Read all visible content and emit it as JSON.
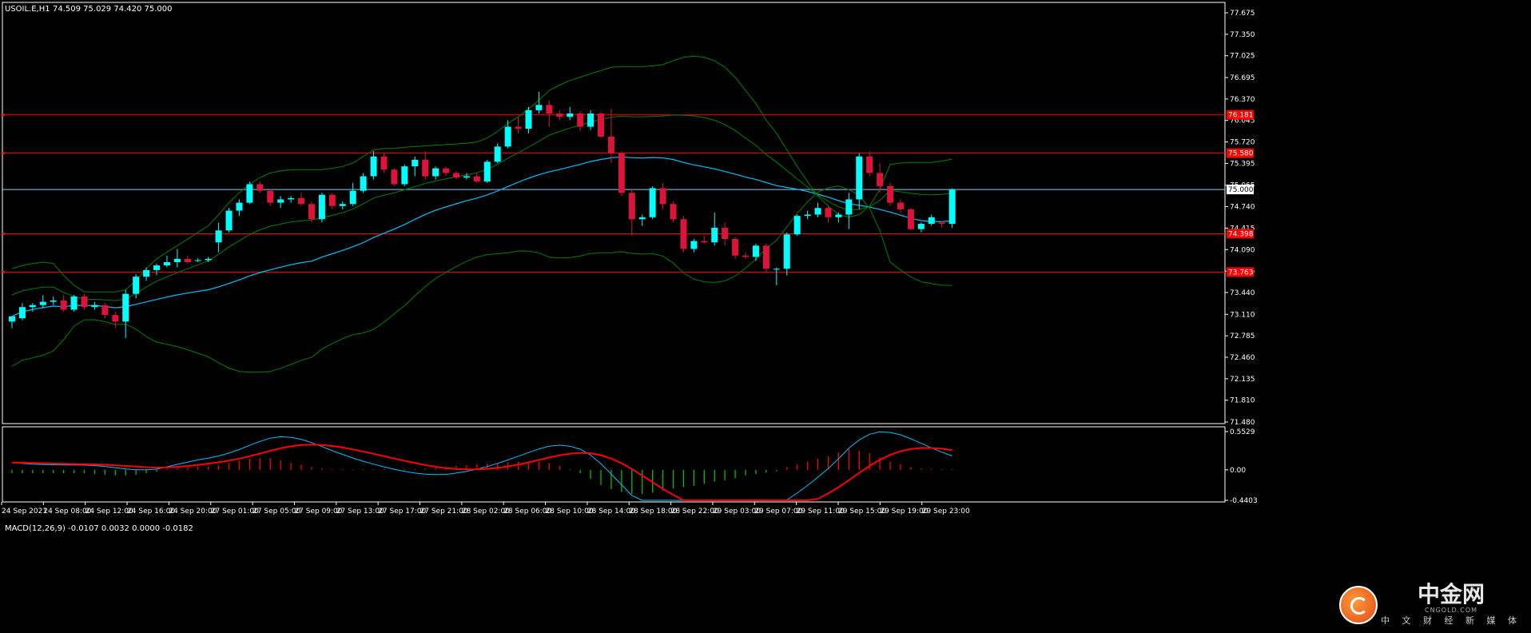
{
  "header": {
    "symbol": "USOIL.E,H1",
    "ohlc": "74.509 75.029 74.420 75.000",
    "macd_title": "MACD(12,26,9) -0.0107 0.0032 0.0000 -0.0182"
  },
  "colors": {
    "background": "#000000",
    "bull": "#00ffff",
    "bear": "#dc143c",
    "band": "#008000",
    "ma": "#00bfff",
    "hline": "#ff0000",
    "macd_signal": "#ff0000",
    "macd_line": "#00bfff",
    "hist_pos": "#ff0000",
    "hist_neg": "#00c000",
    "grid": "#ffffff"
  },
  "chart_data": [
    {
      "type": "candlestick",
      "symbol": "USOIL.E",
      "timeframe": "H1",
      "ylim": [
        71.48,
        77.675
      ],
      "y_ticks": [
        "77.675",
        "77.350",
        "77.025",
        "76.695",
        "76.370",
        "76.045",
        "75.720",
        "75.395",
        "75.065",
        "74.740",
        "74.415",
        "74.090",
        "73.765",
        "73.440",
        "73.110",
        "72.785",
        "72.460",
        "72.135",
        "71.810",
        "71.480"
      ],
      "x_ticks": [
        "24 Sep 2021",
        "24 Sep 08:00",
        "24 Sep 12:00",
        "24 Sep 16:00",
        "24 Sep 20:00",
        "27 Sep 01:00",
        "27 Sep 05:00",
        "27 Sep 09:00",
        "27 Sep 13:00",
        "27 Sep 17:00",
        "27 Sep 21:00",
        "28 Sep 02:00",
        "28 Sep 06:00",
        "28 Sep 10:00",
        "28 Sep 14:00",
        "28 Sep 18:00",
        "28 Sep 22:00",
        "29 Sep 03:00",
        "29 Sep 07:00",
        "29 Sep 11:00",
        "29 Sep 15:00",
        "29 Sep 19:00",
        "29 Sep 23:00"
      ],
      "horizontal_lines": [
        {
          "value": 76.13,
          "label": "76.181"
        },
        {
          "value": 75.55,
          "label": "75.580"
        },
        {
          "value": 74.33,
          "label": "74.398"
        },
        {
          "value": 73.75,
          "label": "73.763"
        }
      ],
      "current_price": {
        "value": 75.0,
        "label": "75.000"
      },
      "candles": [
        [
          73.0,
          73.08,
          72.9,
          73.08
        ],
        [
          73.05,
          73.28,
          73.02,
          73.22
        ],
        [
          73.22,
          73.28,
          73.15,
          73.25
        ],
        [
          73.25,
          73.4,
          73.2,
          73.3
        ],
        [
          73.3,
          73.38,
          73.25,
          73.32
        ],
        [
          73.32,
          73.4,
          73.15,
          73.18
        ],
        [
          73.18,
          73.4,
          73.15,
          73.38
        ],
        [
          73.38,
          73.42,
          73.18,
          73.22
        ],
        [
          73.22,
          73.3,
          73.18,
          73.25
        ],
        [
          73.25,
          73.28,
          73.05,
          73.1
        ],
        [
          73.1,
          73.15,
          72.9,
          73.0
        ],
        [
          73.0,
          73.48,
          72.75,
          73.42
        ],
        [
          73.42,
          73.72,
          73.35,
          73.68
        ],
        [
          73.68,
          73.82,
          73.62,
          73.78
        ],
        [
          73.78,
          73.88,
          73.7,
          73.85
        ],
        [
          73.85,
          74.0,
          73.82,
          73.9
        ],
        [
          73.9,
          74.1,
          73.82,
          73.95
        ],
        [
          73.95,
          74.0,
          73.88,
          73.9
        ],
        [
          73.92,
          73.96,
          73.9,
          73.93
        ],
        [
          73.93,
          73.98,
          73.9,
          73.95
        ],
        [
          74.2,
          74.5,
          74.05,
          74.38
        ],
        [
          74.38,
          74.72,
          74.35,
          74.68
        ],
        [
          74.68,
          74.85,
          74.6,
          74.8
        ],
        [
          74.8,
          75.12,
          74.78,
          75.08
        ],
        [
          75.08,
          75.12,
          74.95,
          74.98
        ],
        [
          74.98,
          75.0,
          74.75,
          74.8
        ],
        [
          74.8,
          74.9,
          74.72,
          74.85
        ],
        [
          74.85,
          74.9,
          74.8,
          74.87
        ],
        [
          74.87,
          74.95,
          74.75,
          74.78
        ],
        [
          74.78,
          74.82,
          74.5,
          74.55
        ],
        [
          74.55,
          74.95,
          74.5,
          74.92
        ],
        [
          74.92,
          74.95,
          74.7,
          74.75
        ],
        [
          74.75,
          74.82,
          74.7,
          74.78
        ],
        [
          74.78,
          75.1,
          74.75,
          74.98
        ],
        [
          74.98,
          75.25,
          74.95,
          75.2
        ],
        [
          75.2,
          75.58,
          75.15,
          75.5
        ],
        [
          75.5,
          75.55,
          75.25,
          75.3
        ],
        [
          75.3,
          75.32,
          75.05,
          75.08
        ],
        [
          75.08,
          75.38,
          75.05,
          75.35
        ],
        [
          75.35,
          75.5,
          75.2,
          75.45
        ],
        [
          75.45,
          75.58,
          75.15,
          75.2
        ],
        [
          75.2,
          75.35,
          75.15,
          75.32
        ],
        [
          75.32,
          75.35,
          75.2,
          75.25
        ],
        [
          75.25,
          75.28,
          75.15,
          75.18
        ],
        [
          75.18,
          75.25,
          75.15,
          75.2
        ],
        [
          75.2,
          75.25,
          75.1,
          75.12
        ],
        [
          75.12,
          75.45,
          75.1,
          75.42
        ],
        [
          75.42,
          75.7,
          75.4,
          75.65
        ],
        [
          75.65,
          76.05,
          75.62,
          75.95
        ],
        [
          75.95,
          76.1,
          75.85,
          75.92
        ],
        [
          75.92,
          76.25,
          75.85,
          76.2
        ],
        [
          76.2,
          76.48,
          76.15,
          76.28
        ],
        [
          76.28,
          76.35,
          75.95,
          76.15
        ],
        [
          76.15,
          76.2,
          76.05,
          76.1
        ],
        [
          76.1,
          76.25,
          76.05,
          76.15
        ],
        [
          76.15,
          76.18,
          75.88,
          75.95
        ],
        [
          75.95,
          76.2,
          75.9,
          76.15
        ],
        [
          76.15,
          76.18,
          75.78,
          75.8
        ],
        [
          75.8,
          76.22,
          75.4,
          75.55
        ],
        [
          75.55,
          75.58,
          74.9,
          74.95
        ],
        [
          74.95,
          75.0,
          74.3,
          74.55
        ],
        [
          74.55,
          74.62,
          74.45,
          74.58
        ],
        [
          74.58,
          75.05,
          74.55,
          75.02
        ],
        [
          75.02,
          75.1,
          74.7,
          74.78
        ],
        [
          74.78,
          74.82,
          74.5,
          74.55
        ],
        [
          74.55,
          74.6,
          74.05,
          74.1
        ],
        [
          74.1,
          74.25,
          74.05,
          74.22
        ],
        [
          74.22,
          74.3,
          74.18,
          74.2
        ],
        [
          74.2,
          74.65,
          74.15,
          74.42
        ],
        [
          74.42,
          74.5,
          74.15,
          74.25
        ],
        [
          74.25,
          74.28,
          73.95,
          74.0
        ],
        [
          74.0,
          74.05,
          73.95,
          73.98
        ],
        [
          73.98,
          74.18,
          73.92,
          74.15
        ],
        [
          74.15,
          74.18,
          73.75,
          73.8
        ],
        [
          73.8,
          73.82,
          73.55,
          73.8
        ],
        [
          73.8,
          74.35,
          73.7,
          74.32
        ],
        [
          74.32,
          74.62,
          74.3,
          74.6
        ],
        [
          74.6,
          74.68,
          74.55,
          74.62
        ],
        [
          74.62,
          74.8,
          74.58,
          74.72
        ],
        [
          74.72,
          74.75,
          74.5,
          74.58
        ],
        [
          74.58,
          74.65,
          74.5,
          74.62
        ],
        [
          74.62,
          74.95,
          74.4,
          74.85
        ],
        [
          74.85,
          75.55,
          74.7,
          75.5
        ],
        [
          75.5,
          75.58,
          75.2,
          75.25
        ],
        [
          75.25,
          75.4,
          74.95,
          75.05
        ],
        [
          75.05,
          75.1,
          74.75,
          74.8
        ],
        [
          74.8,
          74.85,
          74.65,
          74.7
        ],
        [
          74.7,
          74.72,
          74.38,
          74.4
        ],
        [
          74.4,
          74.5,
          74.35,
          74.48
        ],
        [
          74.48,
          74.62,
          74.45,
          74.58
        ],
        [
          74.5,
          74.52,
          74.42,
          74.48
        ],
        [
          74.48,
          75.02,
          74.42,
          75.0
        ]
      ],
      "band_upper": [
        73.8,
        73.85,
        73.88,
        73.9,
        73.88,
        73.7,
        73.55,
        73.45,
        73.45,
        73.45,
        73.45,
        73.48,
        73.62,
        73.8,
        73.95,
        74.05,
        74.15,
        74.25,
        74.35,
        74.45,
        74.62,
        74.8,
        74.95,
        75.08,
        75.18,
        75.25,
        75.28,
        75.3,
        75.3,
        75.3,
        75.3,
        75.32,
        75.35,
        75.4,
        75.5,
        75.6,
        75.62,
        75.62,
        75.64,
        75.65,
        75.66,
        75.67,
        75.68,
        75.69,
        75.7,
        75.72,
        75.78,
        75.88,
        76.0,
        76.1,
        76.22,
        76.35,
        76.5,
        76.58,
        76.65,
        76.7,
        76.75,
        76.8,
        76.85,
        76.86,
        76.86,
        76.86,
        76.87,
        76.89,
        76.95,
        77.0,
        77.02,
        77.0,
        76.95,
        76.85,
        76.7,
        76.5,
        76.3,
        76.05,
        75.85,
        75.6,
        75.35,
        75.12,
        74.9,
        74.75,
        74.62,
        74.58,
        74.62,
        74.75,
        75.0,
        75.38,
        75.4,
        75.41,
        75.41,
        75.41,
        75.43,
        75.46
      ]
    }
  ],
  "macd_chart": {
    "type": "macd",
    "ylim": [
      -0.4403,
      0.5529
    ],
    "y_ticks": [
      "0.5529",
      "0.00",
      "-0.4403"
    ],
    "zero": 0.0,
    "hist_scale_note": "histogram bars around zero",
    "histogram": [
      -0.05,
      -0.05,
      -0.05,
      -0.05,
      -0.05,
      -0.05,
      -0.05,
      -0.05,
      -0.06,
      -0.07,
      -0.08,
      -0.08,
      -0.07,
      -0.05,
      -0.03,
      0.02,
      0.03,
      0.04,
      0.05,
      0.05,
      0.07,
      0.1,
      0.13,
      0.16,
      0.17,
      0.17,
      0.14,
      0.1,
      0.07,
      0.04,
      0.02,
      0.01,
      0.01,
      0.01,
      0.01,
      0.01,
      0.01,
      0.01,
      0.01,
      0.01,
      0.02,
      0.03,
      0.04,
      0.06,
      0.07,
      0.08,
      0.09,
      0.1,
      0.11,
      0.12,
      0.12,
      0.12,
      0.1,
      0.06,
      0.01,
      -0.05,
      -0.13,
      -0.22,
      -0.28,
      -0.32,
      -0.35,
      -0.35,
      -0.33,
      -0.3,
      -0.27,
      -0.25,
      -0.23,
      -0.2,
      -0.17,
      -0.15,
      -0.12,
      -0.08,
      -0.06,
      -0.04,
      -0.02,
      0.04,
      0.08,
      0.12,
      0.16,
      0.2,
      0.25,
      0.3,
      0.28,
      0.24,
      0.18,
      0.12,
      0.08,
      0.04,
      0.02,
      0.01,
      0.01,
      0.01
    ]
  },
  "watermark": {
    "brand_cn": "中金网",
    "brand_url": "CNGOLD.COM",
    "brand_sub": "中 文 财 经 新 媒 体"
  }
}
